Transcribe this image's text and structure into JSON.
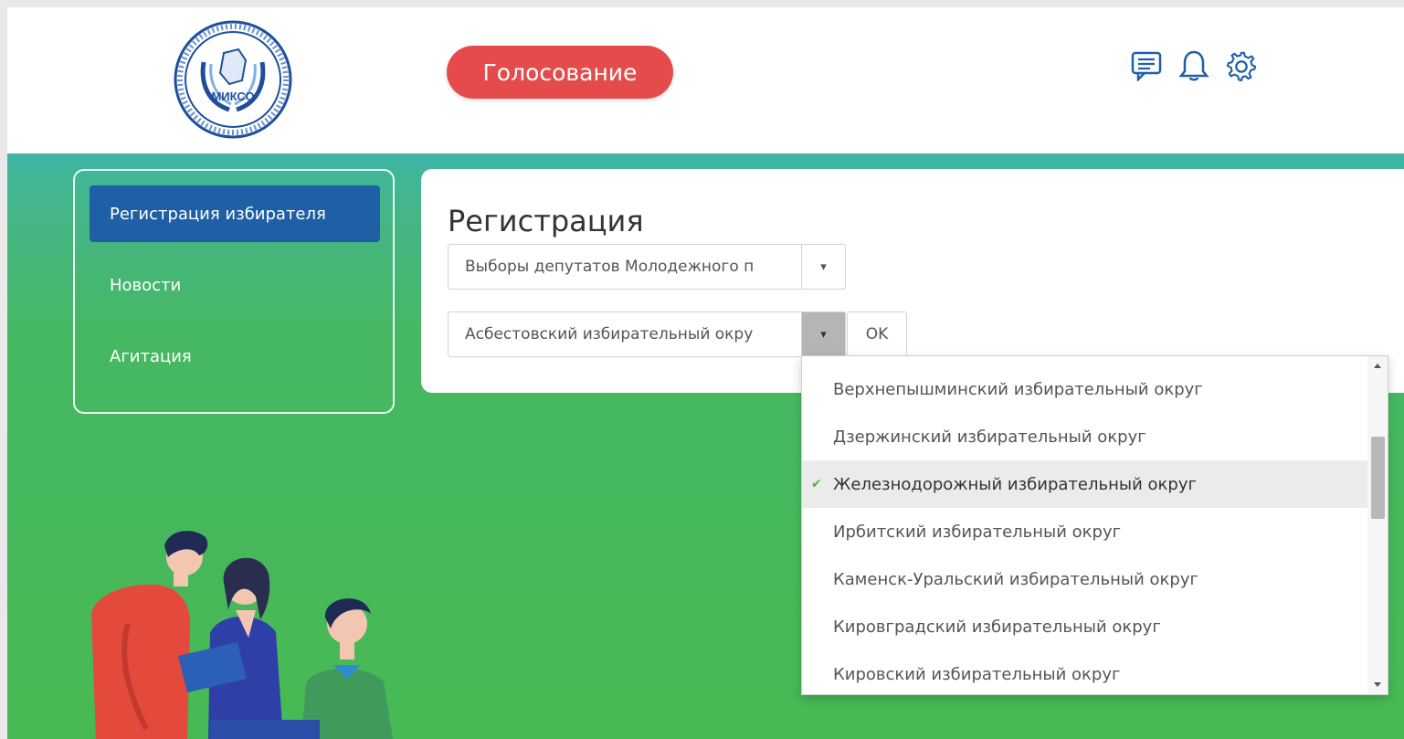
{
  "logo": {
    "text": "МИКСО"
  },
  "header": {
    "vote_button": "Голосование",
    "icons": [
      "chat-icon",
      "bell-icon",
      "gear-icon"
    ]
  },
  "sidebar": {
    "items": [
      {
        "label": "Регистрация избирателя",
        "active": true
      },
      {
        "label": "Новости",
        "active": false
      },
      {
        "label": "Агитация",
        "active": false
      }
    ]
  },
  "registration": {
    "title": "Регистрация",
    "election_select": "Выборы депутатов Молодежного п",
    "district_select": "Асбестовский избирательный окру",
    "ok_button": "OK"
  },
  "dropdown": {
    "items": [
      {
        "label": "Верхнепышминский избирательный округ",
        "selected": false
      },
      {
        "label": "Дзержинский избирательный округ",
        "selected": false
      },
      {
        "label": "Железнодорожный избирательный округ",
        "selected": true
      },
      {
        "label": "Ирбитский избирательный округ",
        "selected": false
      },
      {
        "label": "Каменск-Уральский избирательный округ",
        "selected": false
      },
      {
        "label": "Кировградский избирательный округ",
        "selected": false
      },
      {
        "label": "Кировский избирательный округ",
        "selected": false
      }
    ]
  },
  "colors": {
    "vote_button": "#e64b4b",
    "sidebar_active": "#1f5fa5",
    "background_green": "#47b954",
    "teal_top": "#3fb5a0"
  }
}
